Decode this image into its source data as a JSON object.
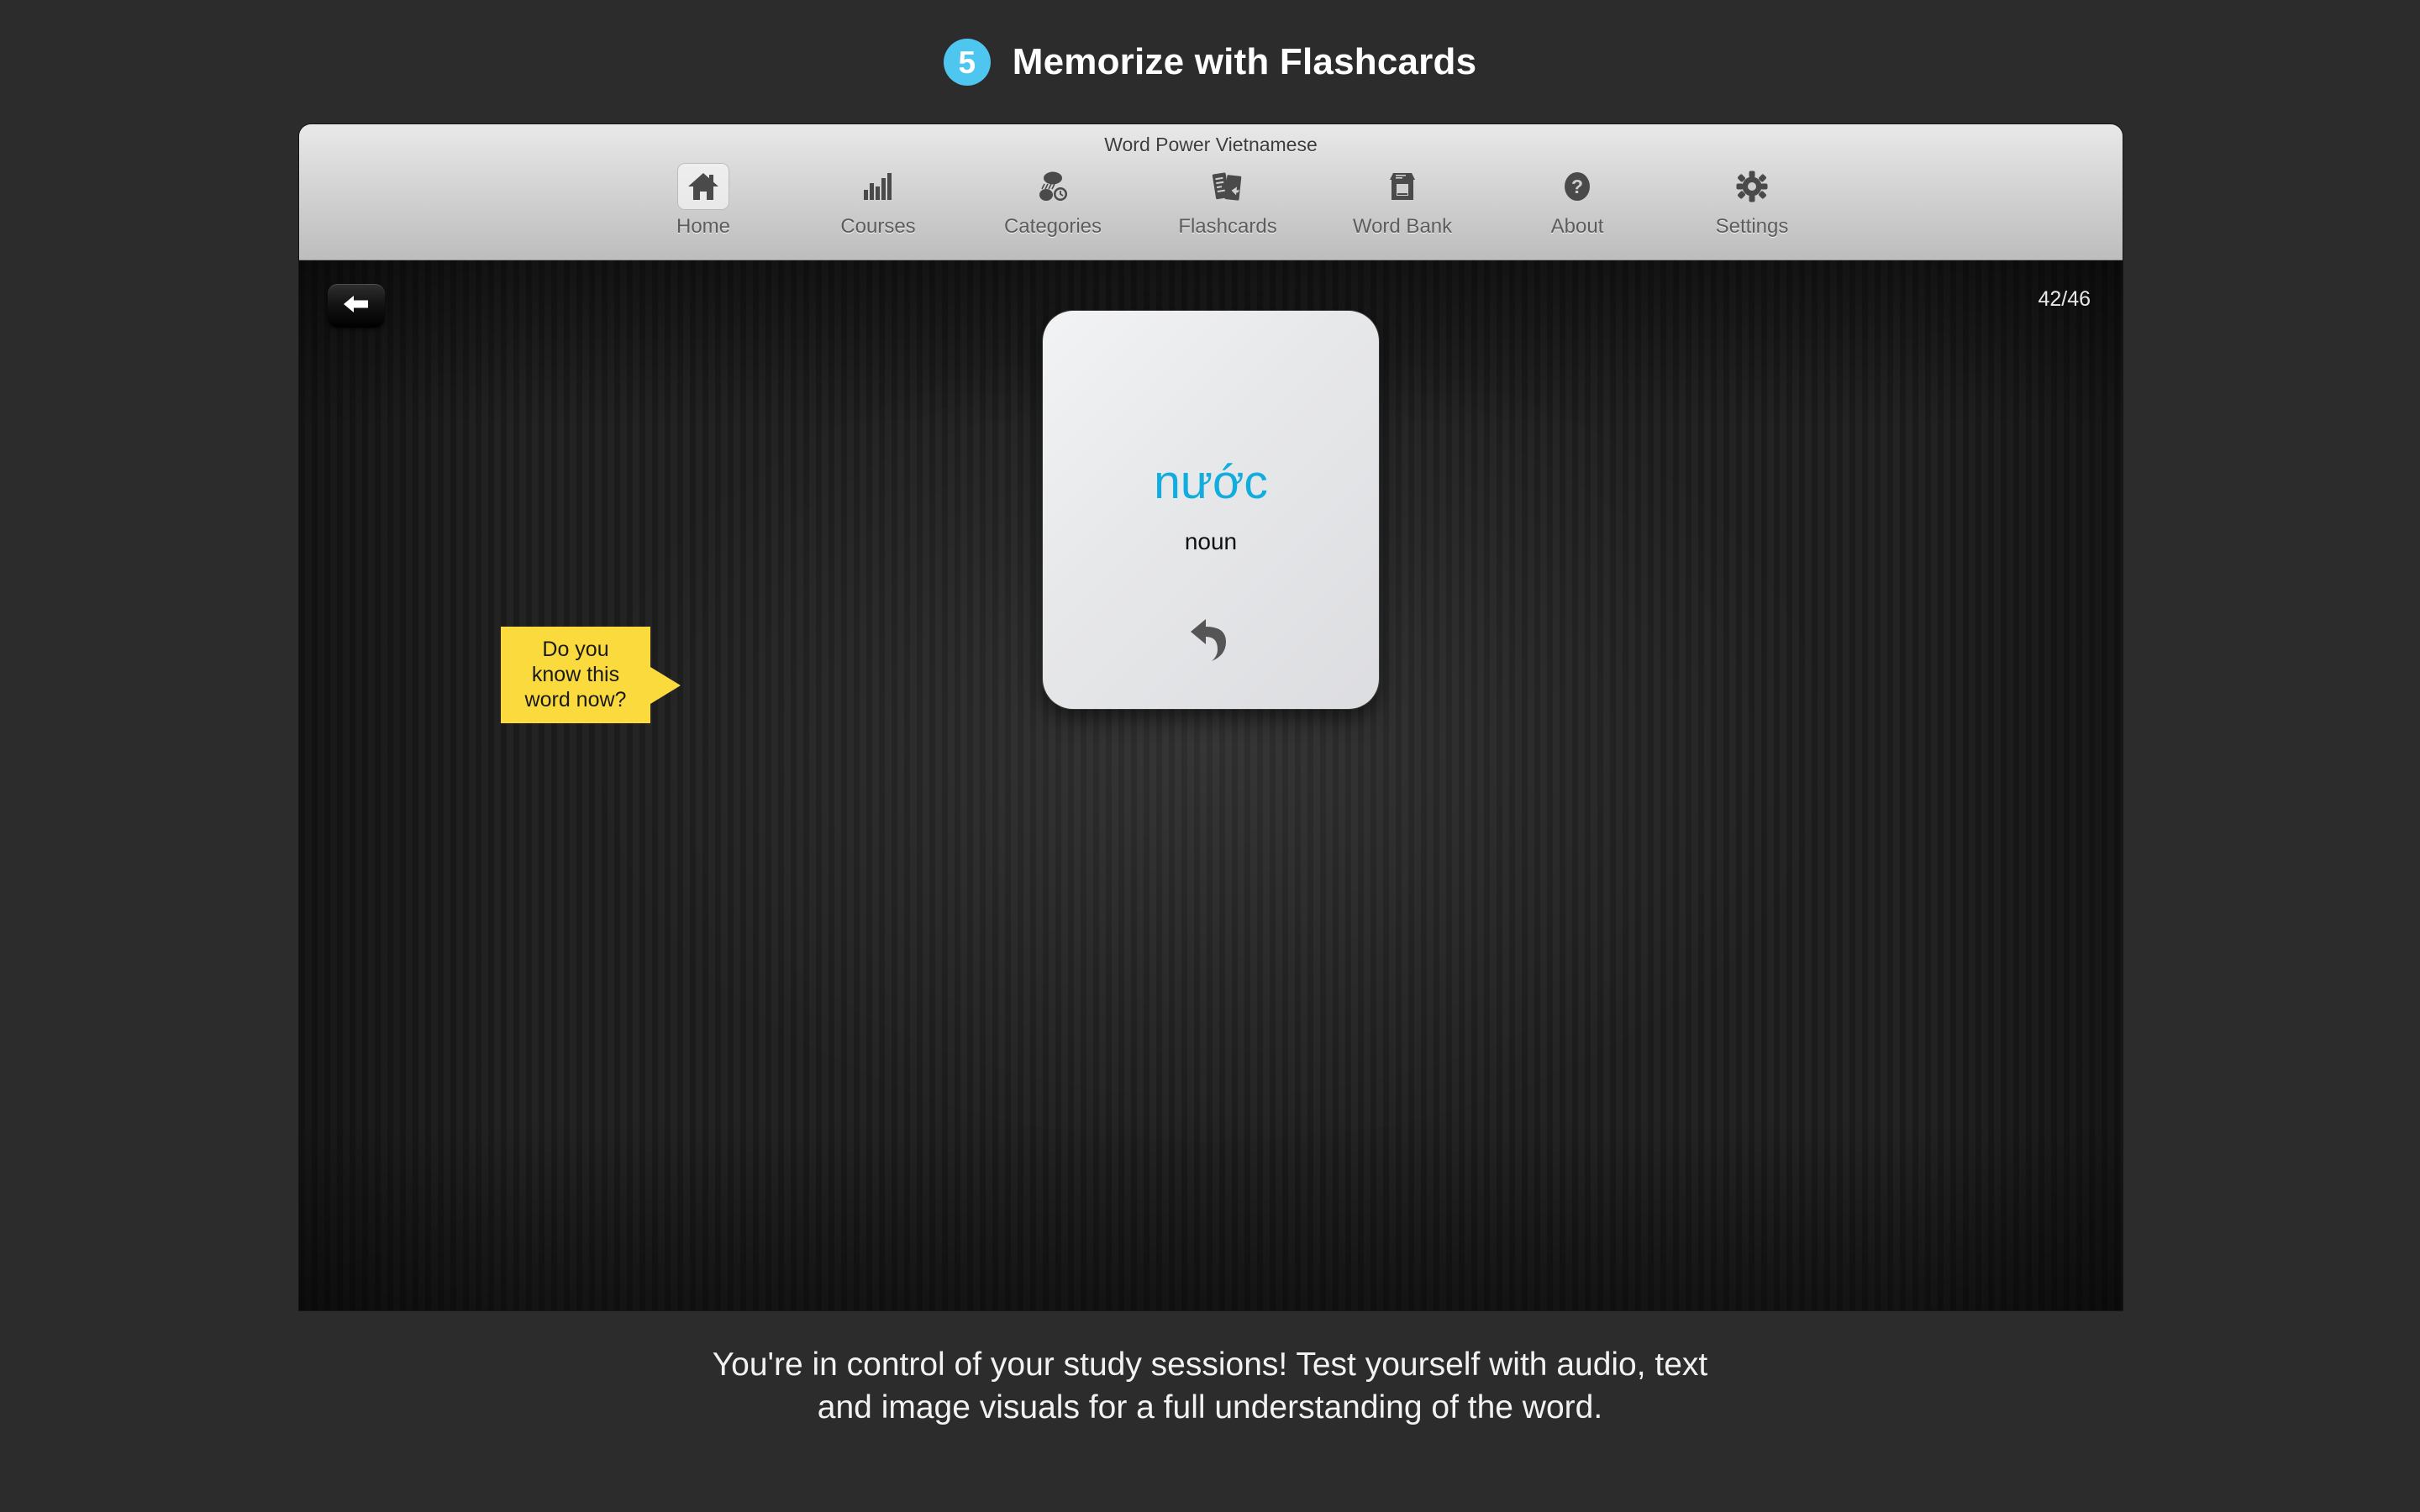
{
  "header": {
    "step_number": "5",
    "title": "Memorize with Flashcards",
    "badge_color": "#4ec6ef"
  },
  "window": {
    "title": "Word Power Vietnamese",
    "toolbar": [
      {
        "label": "Home",
        "icon": "home-icon",
        "selected": true
      },
      {
        "label": "Courses",
        "icon": "bar-chart-icon",
        "selected": false
      },
      {
        "label": "Categories",
        "icon": "categories-icon",
        "selected": false
      },
      {
        "label": "Flashcards",
        "icon": "flashcards-icon",
        "selected": false
      },
      {
        "label": "Word Bank",
        "icon": "word-bank-icon",
        "selected": false
      },
      {
        "label": "About",
        "icon": "question-mark-icon",
        "selected": false
      },
      {
        "label": "Settings",
        "icon": "gear-icon",
        "selected": false
      }
    ],
    "search": {
      "value": "",
      "placeholder": "",
      "icon": "search-icon"
    }
  },
  "stage": {
    "back_button_icon": "arrow-left-icon",
    "counter": "42/46",
    "flashcard": {
      "word": "nước",
      "word_color": "#11addf",
      "part_of_speech": "noun",
      "flip_icon": "flip-arrow-icon"
    },
    "callout": {
      "text": "Do you\nknow this\nword now?",
      "color": "#fada3c"
    }
  },
  "caption": {
    "line1": "You're in control of your study sessions! Test yourself with audio, text",
    "line2": "and image visuals for a full understanding of the word."
  }
}
